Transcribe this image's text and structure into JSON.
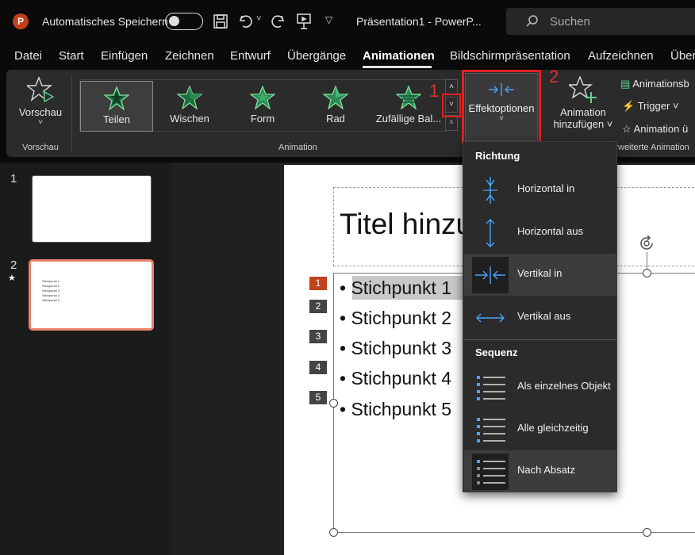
{
  "titlebar": {
    "autosave_label": "Automatisches Speichern",
    "doc_title": "Präsentation1  -  PowerP...",
    "search_placeholder": "Suchen"
  },
  "tabs": [
    "Datei",
    "Start",
    "Einfügen",
    "Zeichnen",
    "Entwurf",
    "Übergänge",
    "Animationen",
    "Bildschirmpräsentation",
    "Aufzeichnen",
    "Über"
  ],
  "ribbon": {
    "preview_label": "Vorschau",
    "preview_group": "Vorschau",
    "gallery": [
      "Teilen",
      "Wischen",
      "Form",
      "Rad",
      "Zufällige Bal..."
    ],
    "animation_group": "Animation",
    "effect_options": "Effektoptionen",
    "add_animation": [
      "Animation",
      "hinzufügen ˅"
    ],
    "animation_pane": "Animationsb",
    "trigger": "Trigger ˅",
    "animation_painter": "Animation ü",
    "advanced_group": "Erweiterte Animation"
  },
  "callouts": {
    "one": "1",
    "two": "2"
  },
  "thumbs": {
    "n1": "1",
    "n2": "2",
    "star": "★",
    "lines": [
      "Stichpunkt 1",
      "Stichpunkt 2",
      "Stichpunkt 3",
      "Stichpunkt 4",
      "Stichpunkt 5"
    ]
  },
  "slide": {
    "title": "Titel hinzu",
    "bullets": [
      "Stichpunkt 1",
      "Stichpunkt 2",
      "Stichpunkt 3",
      "Stichpunkt 4",
      "Stichpunkt 5"
    ],
    "tags": [
      "1",
      "2",
      "3",
      "4",
      "5"
    ]
  },
  "menu": {
    "section1": "Richtung",
    "direction": [
      "Horizontal in",
      "Horizontal aus",
      "Vertikal in",
      "Vertikal aus"
    ],
    "section2": "Sequenz",
    "sequence": [
      "Als einzelnes Objekt",
      "Alle gleichzeitig",
      "Nach Absatz"
    ]
  }
}
